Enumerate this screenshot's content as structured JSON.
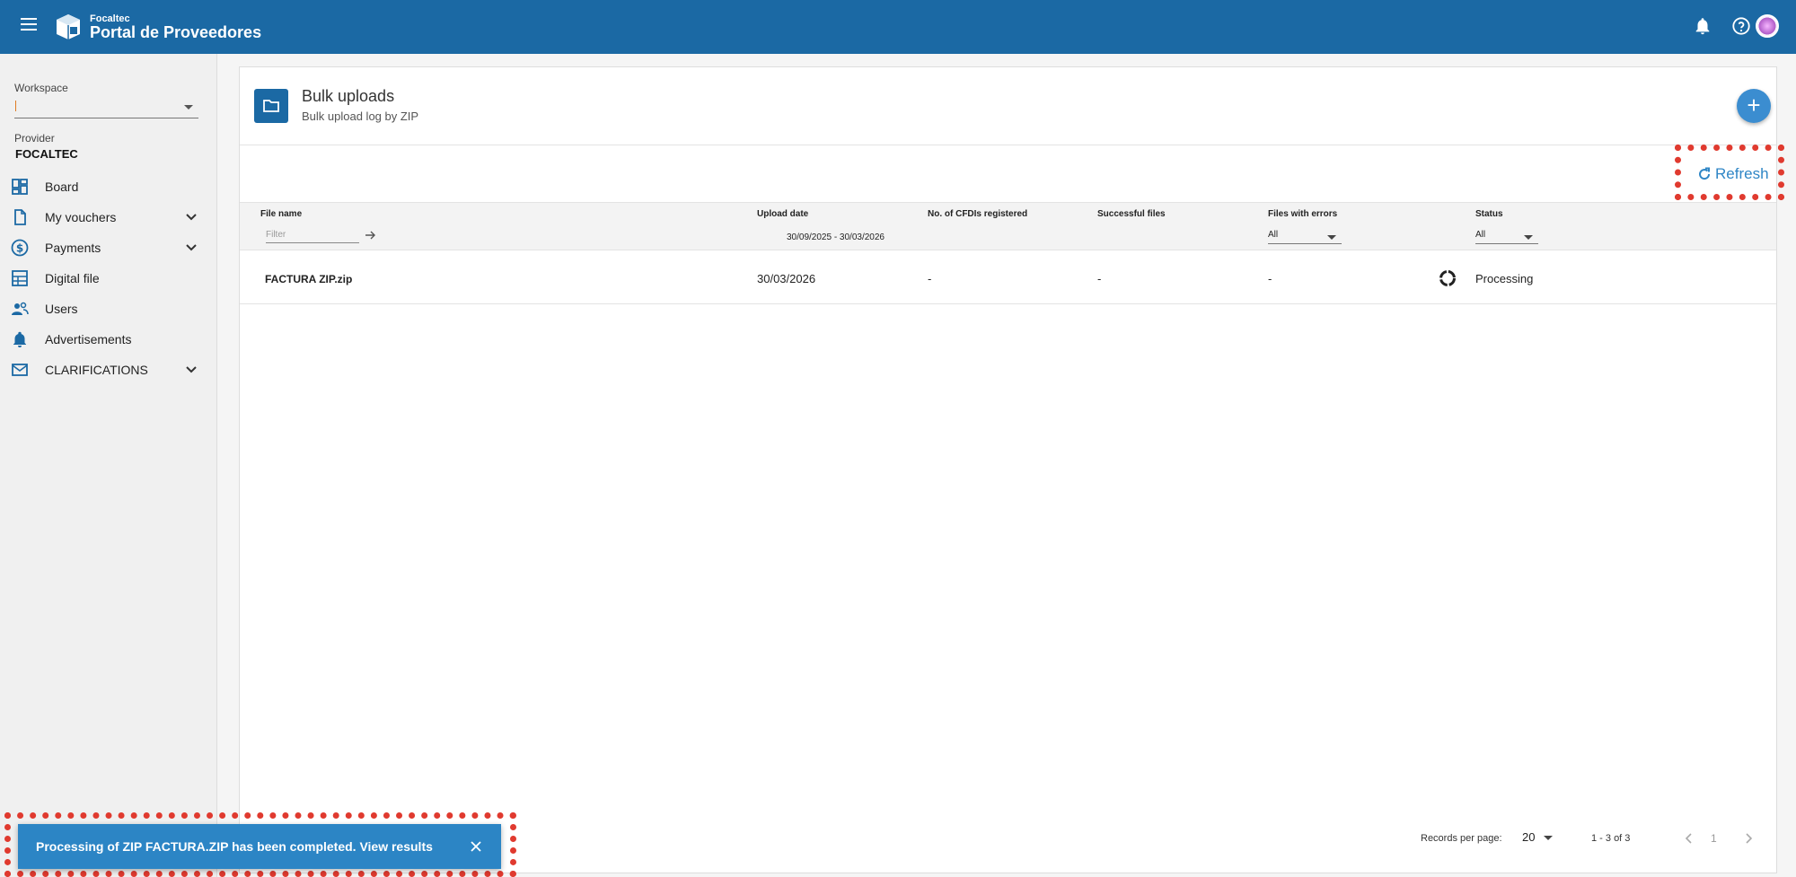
{
  "header": {
    "brand_small": "Focaltec",
    "brand_title": "Portal de Proveedores"
  },
  "sidebar": {
    "workspace_label": "Workspace",
    "workspace_value": "",
    "provider_label": "Provider",
    "provider_value": "FOCALTEC",
    "items": [
      {
        "label": "Board",
        "icon": "dashboard-icon"
      },
      {
        "label": "My vouchers",
        "icon": "document-icon",
        "expandable": true
      },
      {
        "label": "Payments",
        "icon": "dollar-icon",
        "expandable": true
      },
      {
        "label": "Digital file",
        "icon": "digital-file-icon"
      },
      {
        "label": "Users",
        "icon": "users-icon"
      },
      {
        "label": "Advertisements",
        "icon": "bell-icon"
      },
      {
        "label": "CLARIFICATIONS",
        "icon": "mail-icon",
        "expandable": true
      }
    ]
  },
  "page": {
    "title": "Bulk uploads",
    "subtitle": "Bulk upload log by ZIP",
    "refresh_label": "Refresh"
  },
  "table": {
    "columns": [
      "File name",
      "Upload date",
      "No. of CFDIs registered",
      "Successful files",
      "Files with errors",
      "Status"
    ],
    "filter_placeholder": "Filter",
    "date_range": "30/09/2025 - 30/03/2026",
    "errors_filter": "All",
    "status_filter": "All",
    "rows": [
      {
        "file_name": "FACTURA ZIP.zip",
        "upload_date": "30/03/2026",
        "cfdis": "-",
        "successful": "-",
        "errors": "-",
        "status": "Processing"
      }
    ]
  },
  "pagination": {
    "records_per_page_label": "Records per page:",
    "records_per_page": "20",
    "range": "1 - 3 of 3",
    "current_page": "1"
  },
  "toast": {
    "message": "Processing of ZIP FACTURA.ZIP has been completed. View results"
  },
  "colors": {
    "primary": "#1b69a4",
    "accent": "#2f86c6",
    "highlight": "#e03a2f"
  }
}
